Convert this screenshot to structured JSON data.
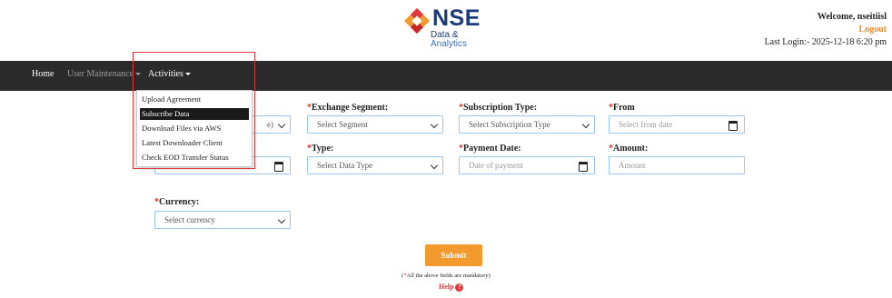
{
  "brand": {
    "name": "NSE",
    "sub_line1": "Data &",
    "sub_line2": "Analytics",
    "colors": {
      "primary": "#1c3a78",
      "orange": "#f39a2e",
      "red": "#e0373c"
    }
  },
  "user": {
    "welcome": "Welcome, nseitiisl",
    "logout": "Logout",
    "last_login": "Last Login:- 2025-12-18 6:20 pm"
  },
  "nav": {
    "home": "Home",
    "user_maintenance": "User Maintenance",
    "activities": "Activities"
  },
  "activities_menu": [
    {
      "label": "Upload Agreement",
      "active": false
    },
    {
      "label": "Subscribe Data",
      "active": true
    },
    {
      "label": "Download Files via AWS",
      "active": false
    },
    {
      "label": "Latest Downloader Client",
      "active": false
    },
    {
      "label": "Check EOD Transfer Status",
      "active": false
    }
  ],
  "form": {
    "required_mark": "*",
    "partial_value_1": "e)",
    "exchange_segment": {
      "label": "Exchange Segment:",
      "value": "Select Segment"
    },
    "subscription_type": {
      "label": "Subscription Type:",
      "value": "Select Subscription Type"
    },
    "from": {
      "label": "From",
      "placeholder": "Select from date"
    },
    "type": {
      "label": "Type:",
      "value": "Select Data Type"
    },
    "payment_date": {
      "label": "Payment Date:",
      "placeholder": "Date of payment"
    },
    "amount": {
      "label": "Amount:",
      "placeholder": "Amount"
    },
    "currency": {
      "label": "Currency:",
      "value": "Select currency"
    },
    "submit": "Submit",
    "mandatory_note_star": "*",
    "mandatory_note": "All the above fields are mandatory",
    "help": "Help",
    "help_icon_glyph": "?"
  }
}
